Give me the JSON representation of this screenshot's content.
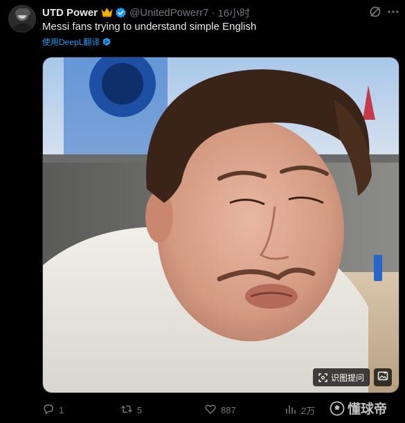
{
  "tweet": {
    "display_name": "UTD Power",
    "handle": "@UnitedPowerr7",
    "separator": "·",
    "time": "16小时",
    "text": "Messi fans trying to understand simple English",
    "translate_label": "使用DeepL翻译"
  },
  "media": {
    "ocr_label": "识图提问",
    "image_button_icon": "image-search-icon"
  },
  "stats": {
    "replies": "1",
    "retweets": "5",
    "likes": "887",
    "views": "2万"
  },
  "watermark": {
    "text": "懂球帝"
  },
  "colors": {
    "background": "#000000",
    "text_primary": "#e7e9ea",
    "text_secondary": "#71767b",
    "link": "#1d9bf0",
    "verified": "#1d9bf0",
    "crown": "#f4b400"
  }
}
